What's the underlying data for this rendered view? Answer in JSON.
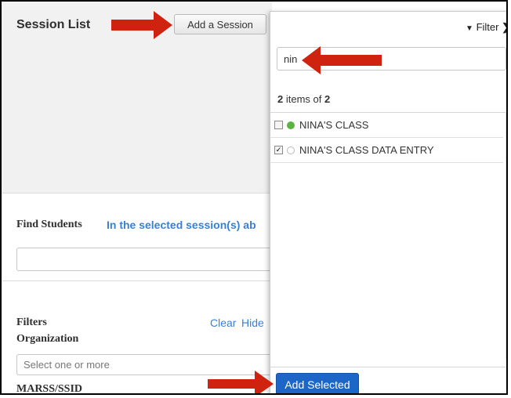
{
  "session_panel": {
    "title": "Session List",
    "add_session_label": "Add a Session"
  },
  "find_students": {
    "label": "Find Students",
    "scope_text": "In the selected session(s) ab"
  },
  "filters": {
    "label": "Filters",
    "clear_label": "Clear",
    "hide_label": "Hide",
    "organization_label": "Organization",
    "organization_placeholder": "Select one or more",
    "marss_label": "MARSS/SSID"
  },
  "session_picker": {
    "filter_label": "Filter",
    "search_value": "nin",
    "count_prefix": "items of",
    "shown": "2",
    "total": "2",
    "items": [
      {
        "label": "NINA'S CLASS",
        "checked": false,
        "status": "active"
      },
      {
        "label": "NINA'S CLASS DATA ENTRY",
        "checked": true,
        "status": "inactive"
      }
    ],
    "add_selected_label": "Add Selected"
  },
  "colors": {
    "annotation_arrow": "#d0230f",
    "primary_button": "#1c66c7",
    "link": "#3a7fd1",
    "active_dot": "#5ab440"
  },
  "icons": {
    "filter": "funnel-icon",
    "expand": "chevron-right-icon",
    "checkbox_checked": "check-icon"
  }
}
